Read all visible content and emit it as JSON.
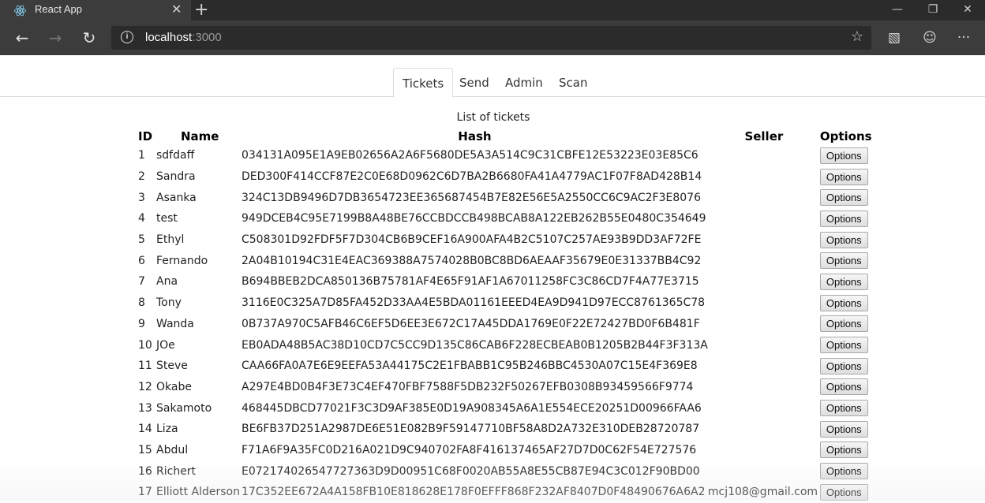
{
  "browser": {
    "tab_title": "React App",
    "tab_close": "✕",
    "new_tab": "+",
    "window_controls": {
      "minimize": "—",
      "restore": "❐",
      "close": "✕"
    },
    "back": "←",
    "forward": "→",
    "refresh": "↻",
    "url_host": "localhost",
    "url_port": ":3000",
    "info_icon": "i",
    "star": "☆",
    "toolbar": {
      "cast": "▧",
      "feedback": "☺",
      "more": "···"
    }
  },
  "nav": {
    "tabs": [
      {
        "label": "Tickets"
      },
      {
        "label": "Send"
      },
      {
        "label": "Admin"
      },
      {
        "label": "Scan"
      }
    ],
    "active": "Tickets"
  },
  "heading": "List of tickets",
  "table": {
    "headers": {
      "id": "ID",
      "name": "Name",
      "hash": "Hash",
      "seller": "Seller",
      "options": "Options"
    },
    "rows": [
      {
        "id": "1",
        "name": "sdfdaff",
        "hash": "034131A095E1A9EB02656A2A6F5680DE5A3A514C9C31CBFE12E53223E03E85C6",
        "seller": "",
        "option": "Options"
      },
      {
        "id": "2",
        "name": "Sandra",
        "hash": "DED300F414CCF87E2C0E68D0962C6D7BA2B6680FA41A4779AC1F07F8AD428B14",
        "seller": "",
        "option": "Options"
      },
      {
        "id": "3",
        "name": "Asanka",
        "hash": "324C13DB9496D7DB3654723EE365687454B7E82E56E5A2550CC6C9AC2F3E8076",
        "seller": "",
        "option": "Options"
      },
      {
        "id": "4",
        "name": "test",
        "hash": "949DCEB4C95E7199B8A48BE76CCBDCCB498BCAB8A122EB262B55E0480C354649",
        "seller": "",
        "option": "Options"
      },
      {
        "id": "5",
        "name": "Ethyl",
        "hash": "C508301D92FDF5F7D304CB6B9CEF16A900AFA4B2C5107C257AE93B9DD3AF72FE",
        "seller": "",
        "option": "Options"
      },
      {
        "id": "6",
        "name": "Fernando",
        "hash": "2A04B10194C31E4EAC369388A7574028B0BC8BD6AEAAF35679E0E31337BB4C92",
        "seller": "",
        "option": "Options"
      },
      {
        "id": "7",
        "name": "Ana",
        "hash": "B694BBEB2DCA850136B75781AF4E65F91AF1A67011258FC3C86CD7F4A77E3715",
        "seller": "",
        "option": "Options"
      },
      {
        "id": "8",
        "name": "Tony",
        "hash": "3116E0C325A7D85FA452D33AA4E5BDA01161EEED4EA9D941D97ECC8761365C78",
        "seller": "",
        "option": "Options"
      },
      {
        "id": "9",
        "name": "Wanda",
        "hash": "0B737A970C5AFB46C6EF5D6EE3E672C17A45DDA1769E0F22E72427BD0F6B481F",
        "seller": "",
        "option": "Options"
      },
      {
        "id": "10",
        "name": "JOe",
        "hash": "EB0ADA48B5AC38D10CD7C5CC9D135C86CAB6F228ECBEAB0B1205B2B44F3F313A",
        "seller": "",
        "option": "Options"
      },
      {
        "id": "11",
        "name": "Steve",
        "hash": "CAA66FA0A7E6E9EEFA53A44175C2E1FBABB1C95B246BBC4530A07C15E4F369E8",
        "seller": "",
        "option": "Options"
      },
      {
        "id": "12",
        "name": "Okabe",
        "hash": "A297E4BD0B4F3E73C4EF470FBF7588F5DB232F50267EFB0308B93459566F9774",
        "seller": "",
        "option": "Options"
      },
      {
        "id": "13",
        "name": "Sakamoto",
        "hash": "468445DBCD77021F3C3D9AF385E0D19A908345A6A1E554ECE20251D00966FAA6",
        "seller": "",
        "option": "Options"
      },
      {
        "id": "14",
        "name": "Liza",
        "hash": "BE6FB37D251A2987DE6E51E082B9F59147710BF58A8D2A732E310DEB28720787",
        "seller": "",
        "option": "Options"
      },
      {
        "id": "15",
        "name": "Abdul",
        "hash": "F71A6F9A35FC0D216A021D9C940702FA8F416137465AF27D7D0C62F54E727576",
        "seller": "",
        "option": "Options"
      },
      {
        "id": "16",
        "name": "Richert",
        "hash": "E072174026547727363D9D00951C68F0020AB55A8E55CB87E94C3C012F90BD00",
        "seller": "",
        "option": "Options"
      },
      {
        "id": "17",
        "name": "Elliott Alderson",
        "hash": "17C352EE672A4A158FB10E818628E178F0EFFF868F232AF8407D0F48490676A6A2",
        "seller": "mcj108@gmail.com",
        "option": "Options"
      }
    ]
  }
}
